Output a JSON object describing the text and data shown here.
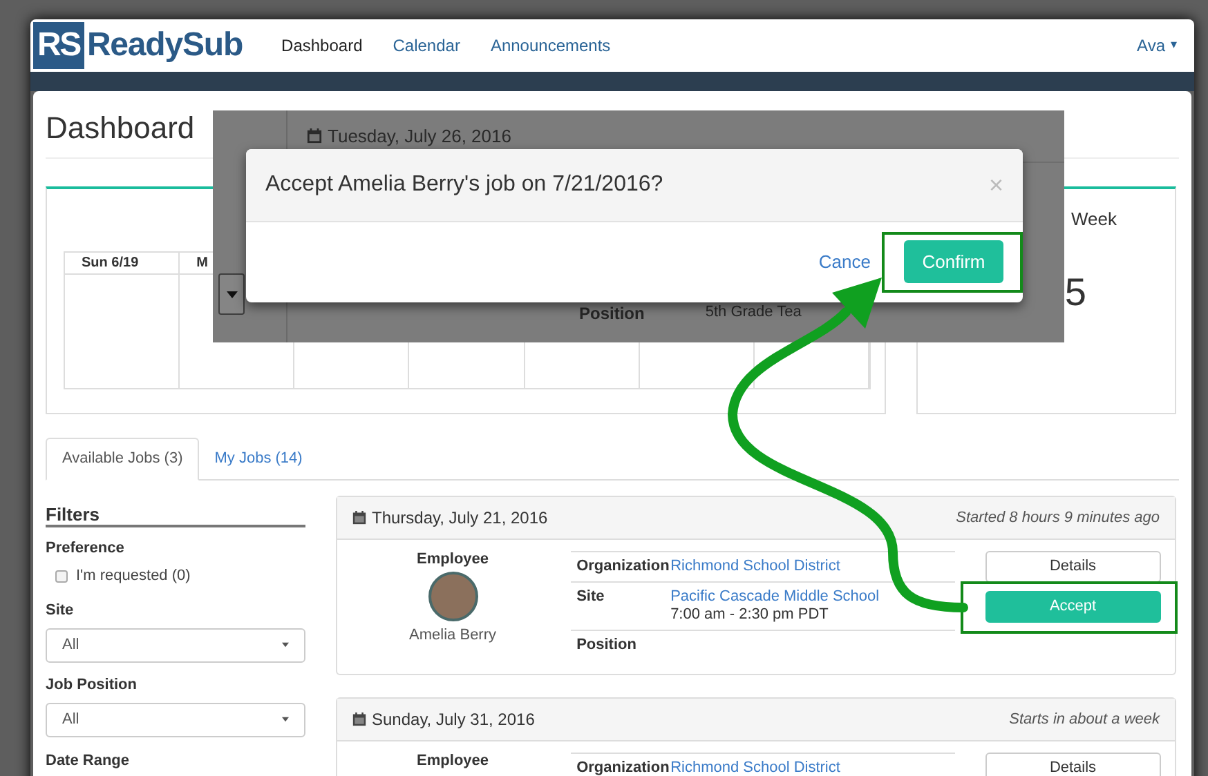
{
  "nav": {
    "logo_mark": "RS",
    "logo_text": "ReadySub",
    "links": [
      {
        "label": "Dashboard",
        "selected": true
      },
      {
        "label": "Calendar",
        "selected": false
      },
      {
        "label": "Announcements",
        "selected": false
      }
    ],
    "user": "Ava",
    "user_caret": "▾"
  },
  "page_title": "Dashboard",
  "calendar": {
    "columns": [
      "Sun 6/19",
      "M"
    ]
  },
  "week_panel": {
    "label": "Week",
    "value": "5"
  },
  "tabs": [
    {
      "label": "Available Jobs (3)",
      "selected": true
    },
    {
      "label": "My Jobs (14)",
      "selected": false
    }
  ],
  "filters": {
    "title": "Filters",
    "sections": [
      {
        "kind": "checkbox",
        "label": "Preference",
        "option": "I'm requested (0)",
        "checked": false
      },
      {
        "kind": "select",
        "label": "Site",
        "value": "All"
      },
      {
        "kind": "select",
        "label": "Job Position",
        "value": "All"
      },
      {
        "kind": "daterange",
        "label": "Date Range"
      }
    ]
  },
  "jobs": [
    {
      "date": "Thursday, July 21, 2016",
      "status": "Started 8 hours 9 minutes ago",
      "employee_label": "Employee",
      "employee_name": "Amelia Berry",
      "details": [
        {
          "label": "Organization",
          "value": "Richmond School District",
          "link": true
        },
        {
          "label": "Site",
          "value": "Pacific Cascade Middle School",
          "link": true,
          "extra": "7:00 am - 2:30 pm PDT"
        },
        {
          "label": "Position"
        }
      ],
      "buttons": [
        {
          "label": "Details",
          "kind": "default"
        },
        {
          "label": "Accept",
          "kind": "primary"
        }
      ]
    },
    {
      "date": "Sunday, July 31, 2016",
      "status": "Starts in about a week",
      "employee_label": "Employee",
      "details": [
        {
          "label": "Organization",
          "value": "Richmond School District",
          "link": true
        }
      ],
      "buttons": [
        {
          "label": "Details",
          "kind": "default"
        }
      ]
    }
  ],
  "background_popup": {
    "date": "Tuesday, July 26, 2016",
    "field_label": "Position",
    "field_value": "5th Grade Tea"
  },
  "modal": {
    "title": "Accept Amelia Berry's job on 7/21/2016?",
    "close": "×",
    "cancel": "Cance",
    "confirm": "Confirm"
  }
}
